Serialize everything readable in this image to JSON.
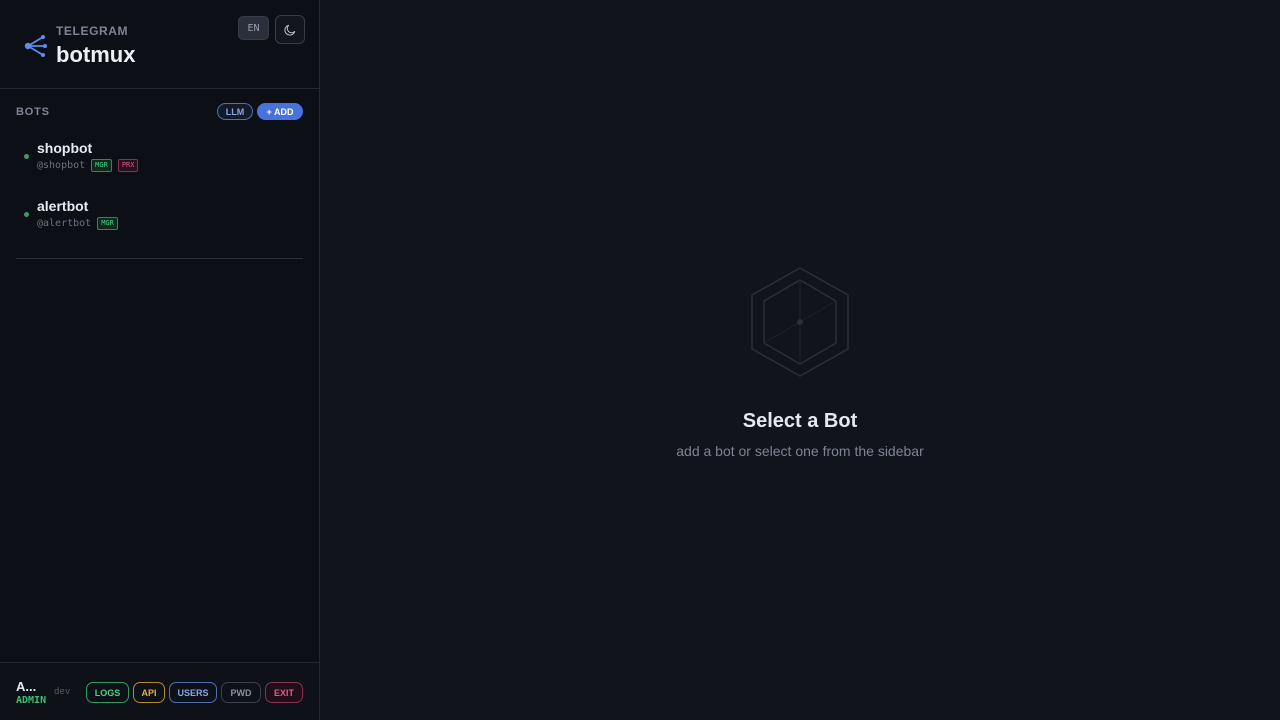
{
  "brand": {
    "subtitle": "TELEGRAM",
    "title": "botmux",
    "lang": "EN"
  },
  "bots_section": {
    "label": "BOTS",
    "llm_button": "LLM",
    "add_button": "+ ADD",
    "items": [
      {
        "name": "shopbot",
        "handle": "@shopbot",
        "tags": [
          "MGR",
          "PRX"
        ]
      },
      {
        "name": "alertbot",
        "handle": "@alertbot",
        "tags": [
          "MGR"
        ]
      }
    ]
  },
  "footer": {
    "user": "A...",
    "role": "ADMIN",
    "env": "dev",
    "buttons": {
      "logs": "LOGS",
      "api": "API",
      "users": "USERS",
      "pwd": "PWD",
      "exit": "EXIT"
    }
  },
  "empty_state": {
    "title": "Select a Bot",
    "subtitle": "add a bot or select one from the sidebar"
  },
  "colors": {
    "accent": "#4a72dc",
    "online": "#3f9a62",
    "mgr": "#4fd188",
    "prx": "#e2588f"
  }
}
